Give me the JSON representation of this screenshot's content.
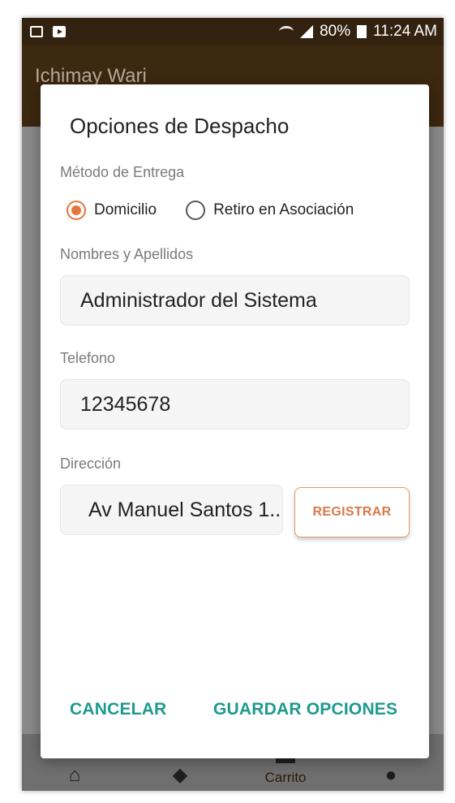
{
  "status_bar": {
    "icons": [
      "image-icon",
      "youtube-icon"
    ],
    "battery": "80%",
    "time": "11:24 AM"
  },
  "app_bar": {
    "title": "Ichimay Wari"
  },
  "bottom_nav": {
    "items": [
      {
        "icon": "home-icon",
        "glyph": "⌂",
        "label": ""
      },
      {
        "icon": "tag-icon",
        "glyph": "◆",
        "label": ""
      },
      {
        "icon": "cart-icon",
        "glyph": "▬",
        "label": "Carrito"
      },
      {
        "icon": "person-icon",
        "glyph": "●",
        "label": ""
      }
    ]
  },
  "dialog": {
    "title": "Opciones de Despacho",
    "delivery_method": {
      "label": "Método de Entrega",
      "options": [
        {
          "label": "Domicilio",
          "selected": true
        },
        {
          "label": "Retiro en Asociación",
          "selected": false
        }
      ]
    },
    "name_field": {
      "label": "Nombres y Apellidos",
      "value": "Administrador del Sistema"
    },
    "phone_field": {
      "label": "Telefono",
      "value": "12345678"
    },
    "address_field": {
      "label": "Dirección",
      "value": "Av Manuel Santos 1.."
    },
    "register_button": "REGISTRAR",
    "actions": {
      "cancel": "CANCELAR",
      "save": "GUARDAR OPCIONES"
    }
  },
  "colors": {
    "app_bar": "#3d2810",
    "accent_orange": "#e8743b",
    "action_teal": "#1d9a8f"
  }
}
